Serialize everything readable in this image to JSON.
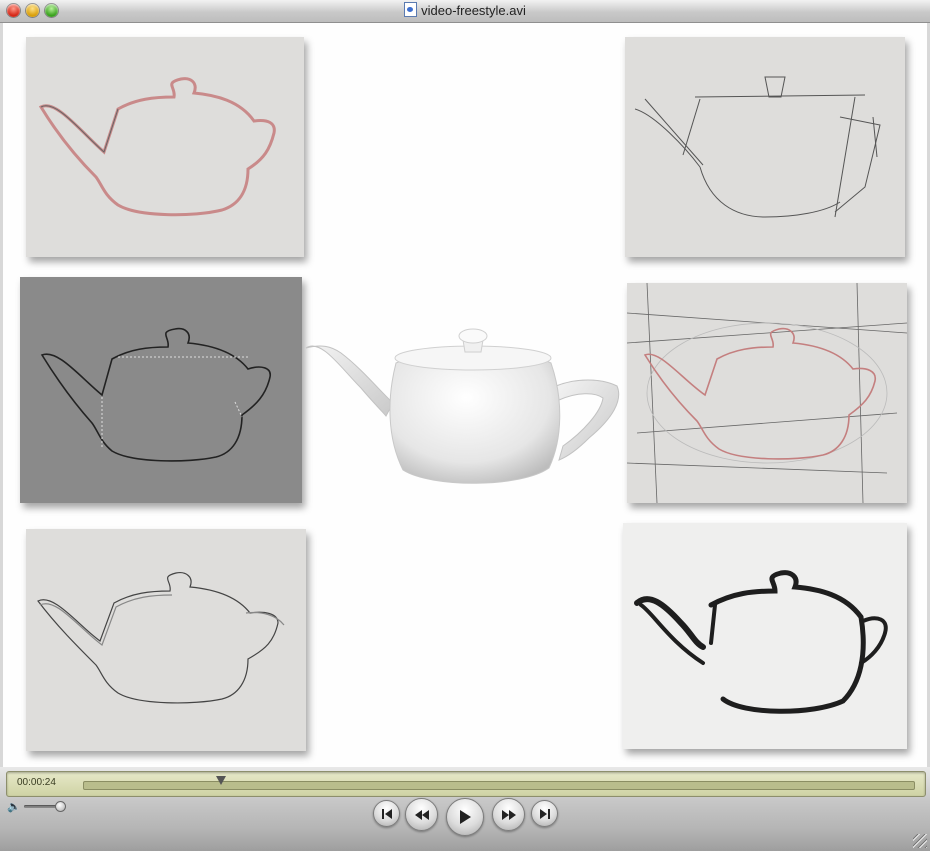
{
  "window": {
    "title": "video-freestyle.avi"
  },
  "player": {
    "timecode": "00:00:24",
    "playhead_fraction": 0.165,
    "volume_fraction": 0.9,
    "buttons": {
      "go_to_start": "go-to-start-icon",
      "rewind": "rewind-icon",
      "play": "play-icon",
      "fast_forward": "fast-forward-icon",
      "go_to_end": "go-to-end-icon"
    }
  },
  "colors": {
    "lcd": "#d8dbb4",
    "panel": "#dedddb",
    "panel_dark": "#8a8a8a",
    "sketch_red": "#c98a8a"
  }
}
